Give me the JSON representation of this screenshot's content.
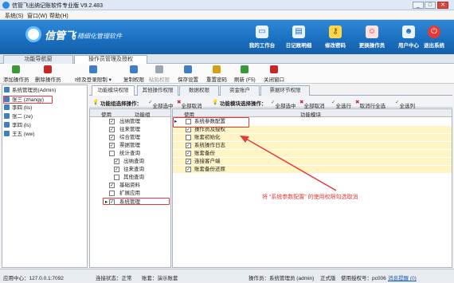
{
  "window": {
    "title": "信管飞出纳记账软件专业版 V9.2.483",
    "minimize": "_",
    "maximize": "□",
    "close": "✕"
  },
  "menu": [
    "系统(S)",
    "窗口(W)",
    "帮助(H)"
  ],
  "banner": {
    "logo": "信管飞",
    "slogan": "• 精细化管理软件",
    "tools": [
      {
        "label": "我的工作台",
        "icon": "monitor-icon",
        "color": "#ffffff"
      },
      {
        "label": "日记账明细",
        "icon": "ledger-icon",
        "color": "#ffffff"
      },
      {
        "label": "修改密码",
        "icon": "key-icon",
        "color": "#ffd54a"
      },
      {
        "label": "更换操作员",
        "icon": "user-switch-icon",
        "color": "#ff6b6b"
      },
      {
        "label": "用户中心",
        "icon": "user-center-icon",
        "color": "#ffffff"
      },
      {
        "label": "退出系统",
        "icon": "power-icon",
        "color": "#e53935"
      }
    ]
  },
  "tabs": [
    "功能导航窗",
    "操作员管理及授权"
  ],
  "toolbar": [
    {
      "label": "添加操作员",
      "icon": "add-user-icon",
      "color": "#3a9a3a"
    },
    {
      "label": "删除操作员",
      "icon": "delete-user-icon",
      "color": "#c62828"
    },
    {
      "label": "t修及登录限制 ▾",
      "icon": "edit-icon",
      "color": "#3f7fc2"
    },
    {
      "label": "复制权限",
      "icon": "copy-icon",
      "color": "#3f7fc2"
    },
    {
      "label": "粘贴权限",
      "icon": "paste-icon",
      "color": "#9aa6b3"
    },
    {
      "label": "保存设置",
      "icon": "save-icon",
      "color": "#3f7fc2"
    },
    {
      "label": "重置密码",
      "icon": "reset-password-icon",
      "color": "#d4a017"
    },
    {
      "label": "刷新 (F5)",
      "icon": "refresh-icon",
      "color": "#3a9a3a"
    },
    {
      "label": "关闭窗口",
      "icon": "close-window-icon",
      "color": "#c62828"
    }
  ],
  "users": [
    "系统管理员(Admin)",
    "张三 (zhangy)",
    "李四 (lis)",
    "张二 (ze)",
    "李四 (ls)",
    "王五 (ww)"
  ],
  "rightTabs": [
    "功能模块权限",
    "其他操作权限",
    "数据权限",
    "资金账户",
    "票据环节权限"
  ],
  "opbar": {
    "left_label": "功能组选择操作：",
    "select_all": "全部选中",
    "cancel_all": "全部取消",
    "right_label": "功能模块选择操作：",
    "select_all2": "全部选中",
    "cancel_all2": "全部取消",
    "select_row": "全选行",
    "cancel_row": "取消行全选",
    "select_col": "全选列"
  },
  "groupGrid": {
    "headers": [
      "使用",
      "功能组"
    ],
    "rows": [
      {
        "name": "出纳管理",
        "checked": true
      },
      {
        "name": "往来管理",
        "checked": true
      },
      {
        "name": "综合管理",
        "checked": true
      },
      {
        "name": "票据管理",
        "checked": true
      },
      {
        "name": "统计查询",
        "checked": false
      },
      {
        "name": "出纳查询",
        "checked": true
      },
      {
        "name": "往来查询",
        "checked": true
      },
      {
        "name": "其他查询",
        "checked": false
      },
      {
        "name": "基础资料",
        "checked": true
      },
      {
        "name": "扩展应用",
        "checked": false
      },
      {
        "name": "系统管理",
        "checked": true
      }
    ]
  },
  "moduleGrid": {
    "headers": [
      "使用",
      "功能模块"
    ],
    "rows": [
      {
        "name": "系统参数配置",
        "checked": false
      },
      {
        "name": "操作员及授权",
        "checked": true
      },
      {
        "name": "账套初始化",
        "checked": false
      },
      {
        "name": "系统操作日志",
        "checked": true
      },
      {
        "name": "账套备份",
        "checked": true
      },
      {
        "name": "连接客户端",
        "checked": true
      },
      {
        "name": "账套备份还原",
        "checked": true
      }
    ]
  },
  "annotation": "将 “系统参数配置” 的使用权限勾选取消",
  "status": {
    "server": "应用中心：127.0.0.1:7092",
    "conn": "连接状态：正常",
    "account": "账套：演示账套",
    "operator": "操作员：系统管理员 (admin)",
    "edition": "正式版",
    "license": "使用授权号：pc006",
    "msg": "消息提醒 (0)"
  }
}
